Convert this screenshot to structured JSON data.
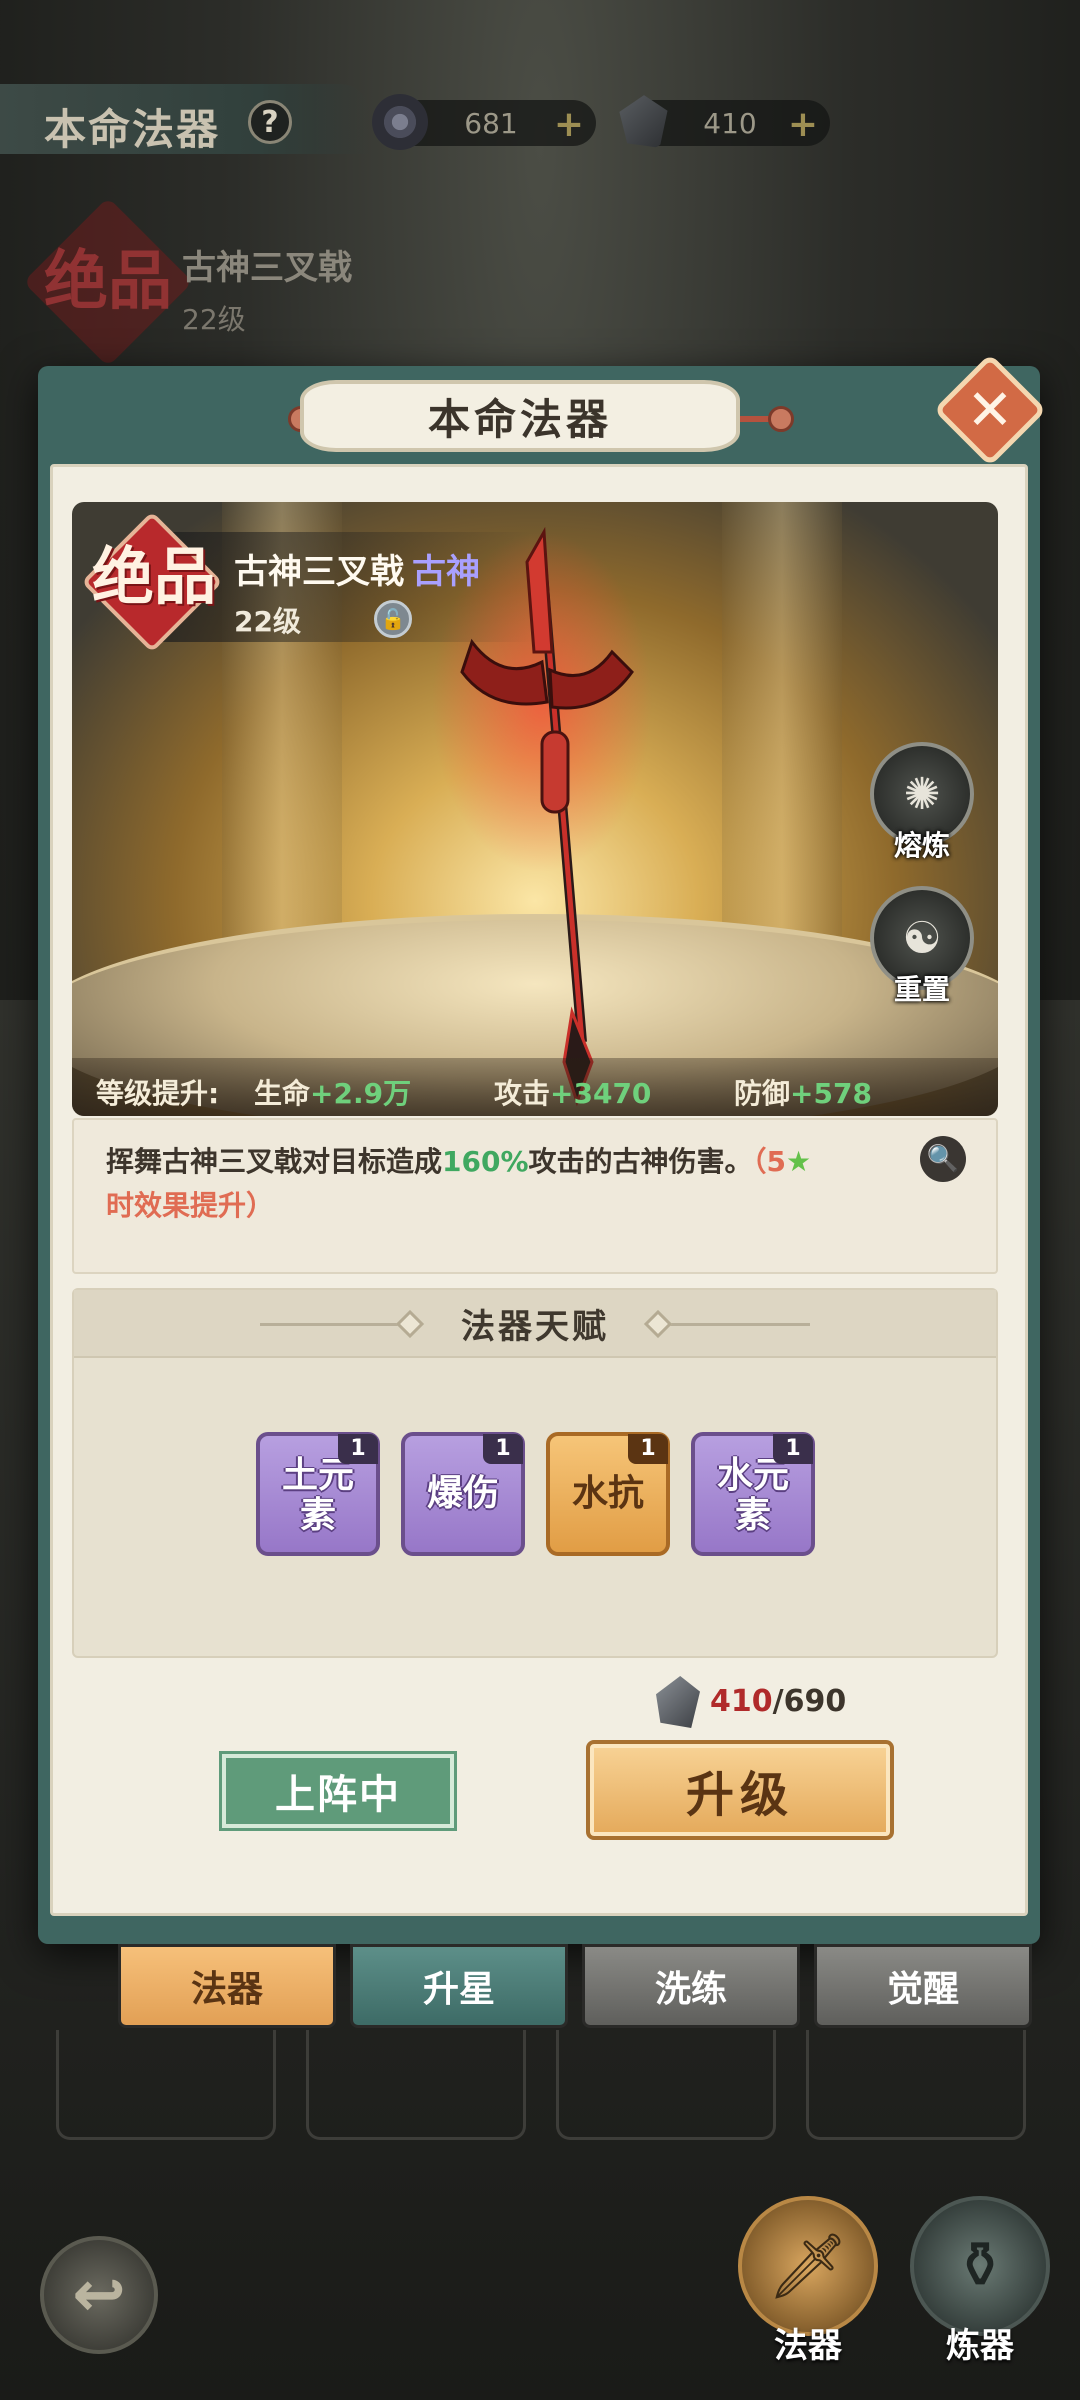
{
  "header": {
    "title": "本命法器",
    "help_icon": "?",
    "currencies": [
      {
        "icon": "spirit-orb-icon",
        "value": "681",
        "plus": "+"
      },
      {
        "icon": "stone-icon",
        "value": "410",
        "plus": "+"
      }
    ]
  },
  "background_item": {
    "badge": "绝品",
    "name": "古神三叉戟",
    "level": "22级"
  },
  "dialog": {
    "title": "本命法器",
    "close_icon": "✕",
    "weapon": {
      "badge": "绝品",
      "name": "古神三叉戟",
      "tag": "古神",
      "level": "22级",
      "lock_icon": "lock-icon"
    },
    "side_buttons": [
      {
        "icon": "smelt-icon",
        "label": "熔炼"
      },
      {
        "icon": "reset-icon",
        "label": "重置"
      }
    ],
    "stats": {
      "label": "等级提升:",
      "hp_label": "生命",
      "hp_value": "+2.9万",
      "atk_label": "攻击",
      "atk_value": "+3470",
      "def_label": "防御",
      "def_value": "+578"
    },
    "description": {
      "part1": "挥舞古神三叉戟对目标造成",
      "percent": "160%",
      "part2": "攻击的古神伤害。",
      "note_open": "（5",
      "star": "★",
      "note_close": "时效果提升）"
    },
    "talent": {
      "title": "法器天赋",
      "items": [
        {
          "line1": "土元",
          "line2": "素",
          "count": "1",
          "color": "purple"
        },
        {
          "line1": "爆伤",
          "line2": "",
          "count": "1",
          "color": "purple"
        },
        {
          "line1": "水抗",
          "line2": "",
          "count": "1",
          "color": "orange"
        },
        {
          "line1": "水元",
          "line2": "素",
          "count": "1",
          "color": "purple"
        }
      ]
    },
    "cost": {
      "have": "410",
      "need": "/690"
    },
    "deploy_label": "上阵中",
    "upgrade_label": "升级"
  },
  "tabs": [
    "法器",
    "升星",
    "洗练",
    "觉醒"
  ],
  "nav": {
    "back_icon": "↩",
    "items": [
      {
        "icon": "sword-icon",
        "label": "法器"
      },
      {
        "icon": "cauldron-icon",
        "label": "炼器"
      }
    ]
  },
  "colors": {
    "dialog_frame": "#3f6661",
    "parchment": "#f2eee2",
    "accent_orange": "#e4a95a",
    "stat_green": "#6fd07c",
    "talent_purple": "#9777c8"
  }
}
